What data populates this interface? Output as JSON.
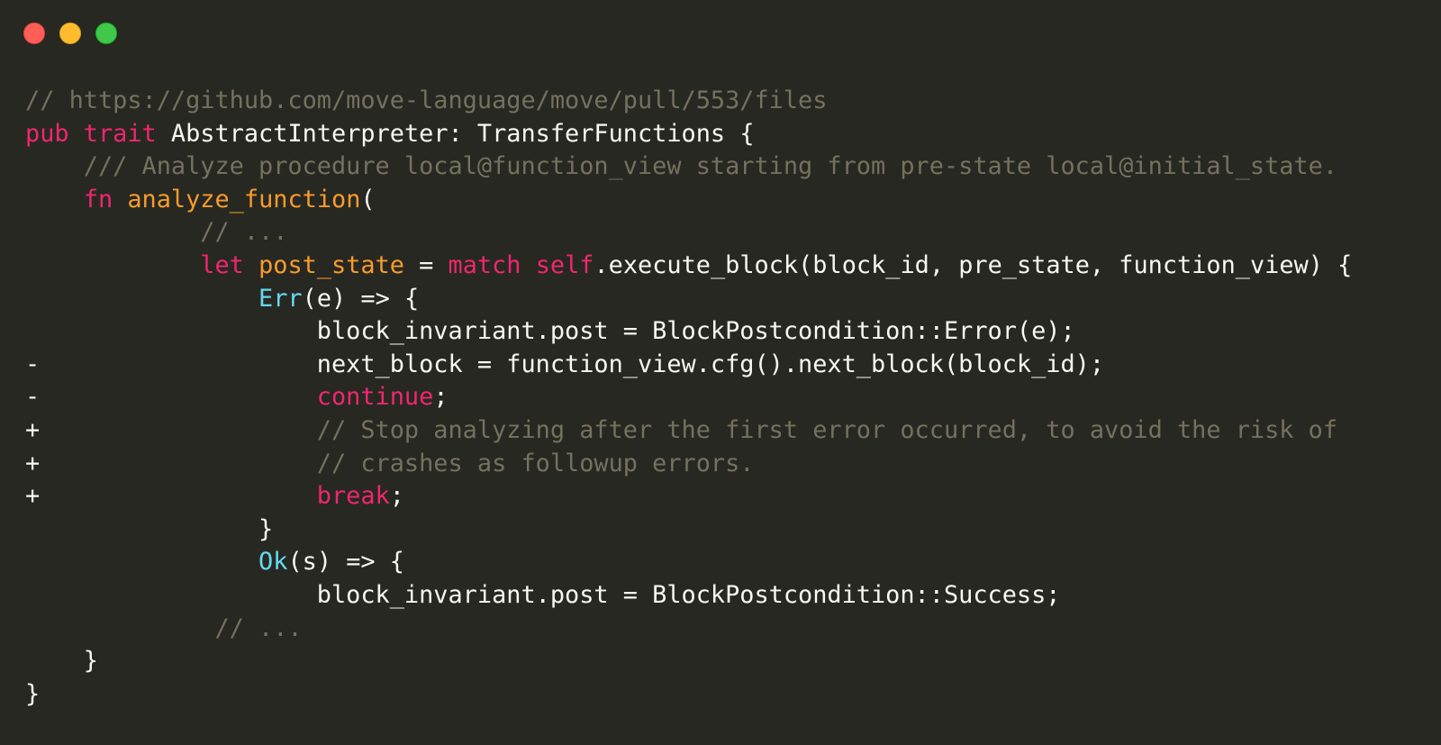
{
  "window": {
    "controls": [
      {
        "name": "close",
        "color": "#ff5f56"
      },
      {
        "name": "minimize",
        "color": "#ffbd2e"
      },
      {
        "name": "maximize",
        "color": "#3fc84a"
      }
    ]
  },
  "theme": {
    "background": "#272822",
    "plain": "#f8f8f2",
    "keyword": "#f0266f",
    "function": "#f99b2c",
    "type": "#66d9ef",
    "comment": "#75715e"
  },
  "code": {
    "lines": [
      {
        "marker": "",
        "tokens": [
          {
            "t": "comment",
            "v": "// https://github.com/move-language/move/pull/553/files"
          }
        ]
      },
      {
        "marker": "",
        "tokens": [
          {
            "t": "keyword",
            "v": "pub"
          },
          {
            "t": "plain",
            "v": " "
          },
          {
            "t": "keyword",
            "v": "trait"
          },
          {
            "t": "plain",
            "v": " AbstractInterpreter: TransferFunctions {"
          }
        ]
      },
      {
        "marker": "",
        "tokens": [
          {
            "t": "comment",
            "v": "    /// Analyze procedure local@function_view starting from pre-state local@initial_state."
          }
        ]
      },
      {
        "marker": "",
        "tokens": [
          {
            "t": "plain",
            "v": "    "
          },
          {
            "t": "keyword",
            "v": "fn"
          },
          {
            "t": "plain",
            "v": " "
          },
          {
            "t": "func",
            "v": "analyze_function"
          },
          {
            "t": "plain",
            "v": "("
          }
        ]
      },
      {
        "marker": "",
        "tokens": [
          {
            "t": "comment",
            "v": "            // ..."
          }
        ]
      },
      {
        "marker": "",
        "tokens": [
          {
            "t": "plain",
            "v": "            "
          },
          {
            "t": "keyword",
            "v": "let"
          },
          {
            "t": "plain",
            "v": " "
          },
          {
            "t": "func",
            "v": "post_state"
          },
          {
            "t": "plain",
            "v": " = "
          },
          {
            "t": "keyword",
            "v": "match"
          },
          {
            "t": "plain",
            "v": " "
          },
          {
            "t": "keyword",
            "v": "self"
          },
          {
            "t": "plain",
            "v": ".execute_block(block_id, pre_state, function_view) {"
          }
        ]
      },
      {
        "marker": "",
        "tokens": [
          {
            "t": "plain",
            "v": "                "
          },
          {
            "t": "type",
            "v": "Err"
          },
          {
            "t": "plain",
            "v": "(e) => {"
          }
        ]
      },
      {
        "marker": "",
        "tokens": [
          {
            "t": "plain",
            "v": "                    block_invariant.post = BlockPostcondition::Error(e);"
          }
        ]
      },
      {
        "marker": "-",
        "tokens": [
          {
            "t": "plain",
            "v": "                    next_block = function_view.cfg().next_block(block_id);"
          }
        ]
      },
      {
        "marker": "-",
        "tokens": [
          {
            "t": "plain",
            "v": "                    "
          },
          {
            "t": "keyword",
            "v": "continue"
          },
          {
            "t": "plain",
            "v": ";"
          }
        ]
      },
      {
        "marker": "+",
        "tokens": [
          {
            "t": "comment",
            "v": "                    // Stop analyzing after the first error occurred, to avoid the risk of"
          }
        ]
      },
      {
        "marker": "+",
        "tokens": [
          {
            "t": "comment",
            "v": "                    // crashes as followup errors."
          }
        ]
      },
      {
        "marker": "+",
        "tokens": [
          {
            "t": "plain",
            "v": "                    "
          },
          {
            "t": "keyword",
            "v": "break"
          },
          {
            "t": "plain",
            "v": ";"
          }
        ]
      },
      {
        "marker": "",
        "tokens": [
          {
            "t": "plain",
            "v": "                }"
          }
        ]
      },
      {
        "marker": "",
        "tokens": [
          {
            "t": "plain",
            "v": "                "
          },
          {
            "t": "type",
            "v": "Ok"
          },
          {
            "t": "plain",
            "v": "(s) => {"
          }
        ]
      },
      {
        "marker": "",
        "tokens": [
          {
            "t": "plain",
            "v": "                    block_invariant.post = BlockPostcondition::Success;"
          }
        ]
      },
      {
        "marker": "",
        "tokens": [
          {
            "t": "comment",
            "v": "             // ..."
          }
        ]
      },
      {
        "marker": "",
        "tokens": [
          {
            "t": "plain",
            "v": "    }"
          }
        ]
      },
      {
        "marker": "",
        "tokens": [
          {
            "t": "plain",
            "v": "}"
          }
        ]
      }
    ]
  }
}
